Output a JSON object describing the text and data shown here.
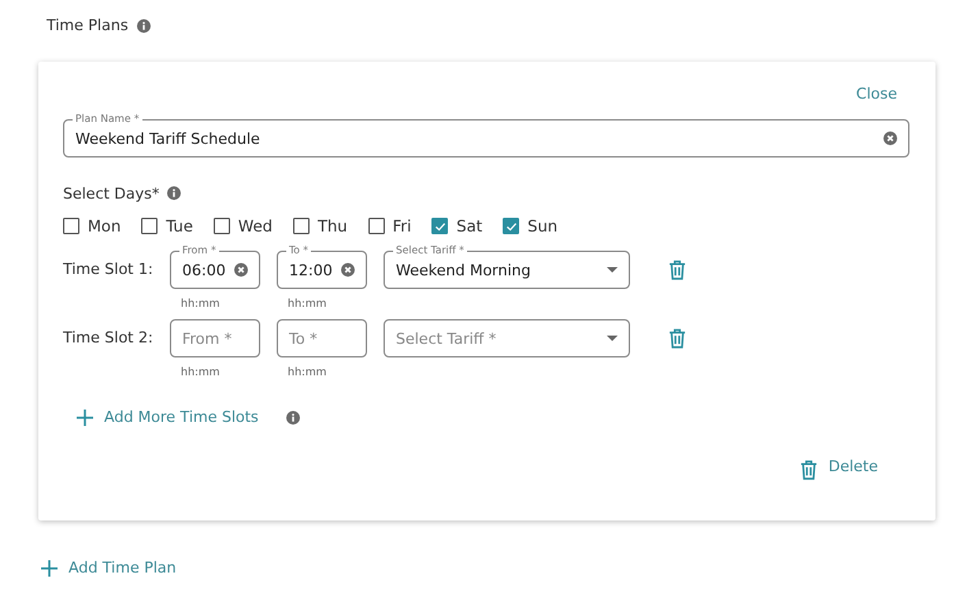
{
  "section_title": "Time Plans",
  "plan": {
    "close_label": "Close",
    "plan_name": {
      "label": "Plan Name *",
      "value": "Weekend Tariff Schedule"
    },
    "days_label": "Select Days*",
    "days": [
      {
        "label": "Mon",
        "checked": false
      },
      {
        "label": "Tue",
        "checked": false
      },
      {
        "label": "Wed",
        "checked": false
      },
      {
        "label": "Thu",
        "checked": false
      },
      {
        "label": "Fri",
        "checked": false
      },
      {
        "label": "Sat",
        "checked": true
      },
      {
        "label": "Sun",
        "checked": true
      }
    ],
    "time_slots": [
      {
        "label": "Time Slot 1:",
        "from": {
          "label": "From *",
          "value": "06:00",
          "hint": "hh:mm"
        },
        "to": {
          "label": "To *",
          "value": "12:00",
          "hint": "hh:mm"
        },
        "tariff": {
          "label": "Select Tariff *",
          "value": "Weekend Morning"
        }
      },
      {
        "label": "Time Slot 2:",
        "from": {
          "placeholder": "From *",
          "hint": "hh:mm"
        },
        "to": {
          "placeholder": "To *",
          "hint": "hh:mm"
        },
        "tariff": {
          "placeholder": "Select Tariff *"
        }
      }
    ],
    "add_slots_label": "Add More Time Slots",
    "delete_label": "Delete"
  },
  "add_plan_label": "Add Time Plan"
}
